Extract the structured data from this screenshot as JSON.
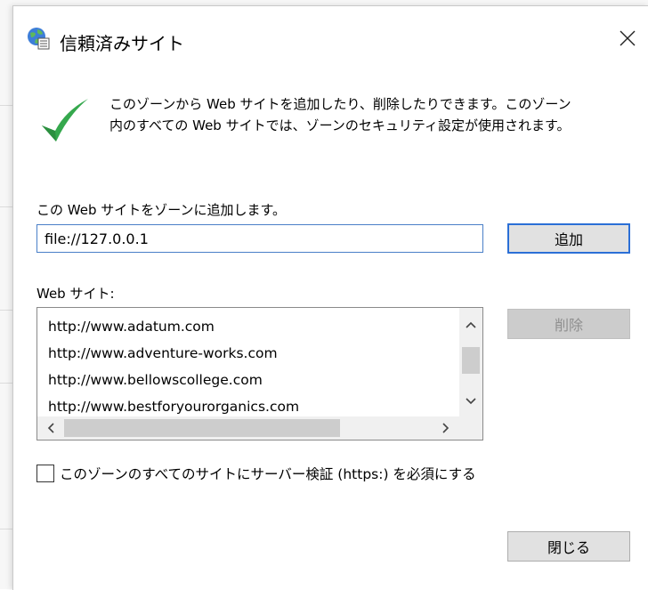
{
  "window": {
    "title": "信頼済みサイト",
    "icon": "globe-check-icon",
    "close_icon": "close-icon"
  },
  "info": {
    "icon": "checkmark-icon",
    "accent": "#2fa34a",
    "line1": "このゾーンから Web サイトを追加したり、削除したりできます。このゾーン",
    "line2": "内のすべての Web サイトでは、ゾーンのセキュリティ設定が使用されます。"
  },
  "add_section": {
    "label": "この Web サイトをゾーンに追加します。",
    "input_value": "file://127.0.0.1",
    "add_button": "追加"
  },
  "sites_section": {
    "label": "Web サイト:",
    "items": [
      "http://www.adatum.com",
      "http://www.adventure-works.com",
      "http://www.bellowscollege.com",
      "http://www.bestforyourorganics.com"
    ],
    "delete_button": "削除"
  },
  "https": {
    "checked": false,
    "label": "このゾーンのすべてのサイトにサーバー検証 (https:) を必須にする"
  },
  "footer": {
    "close_button": "閉じる"
  }
}
